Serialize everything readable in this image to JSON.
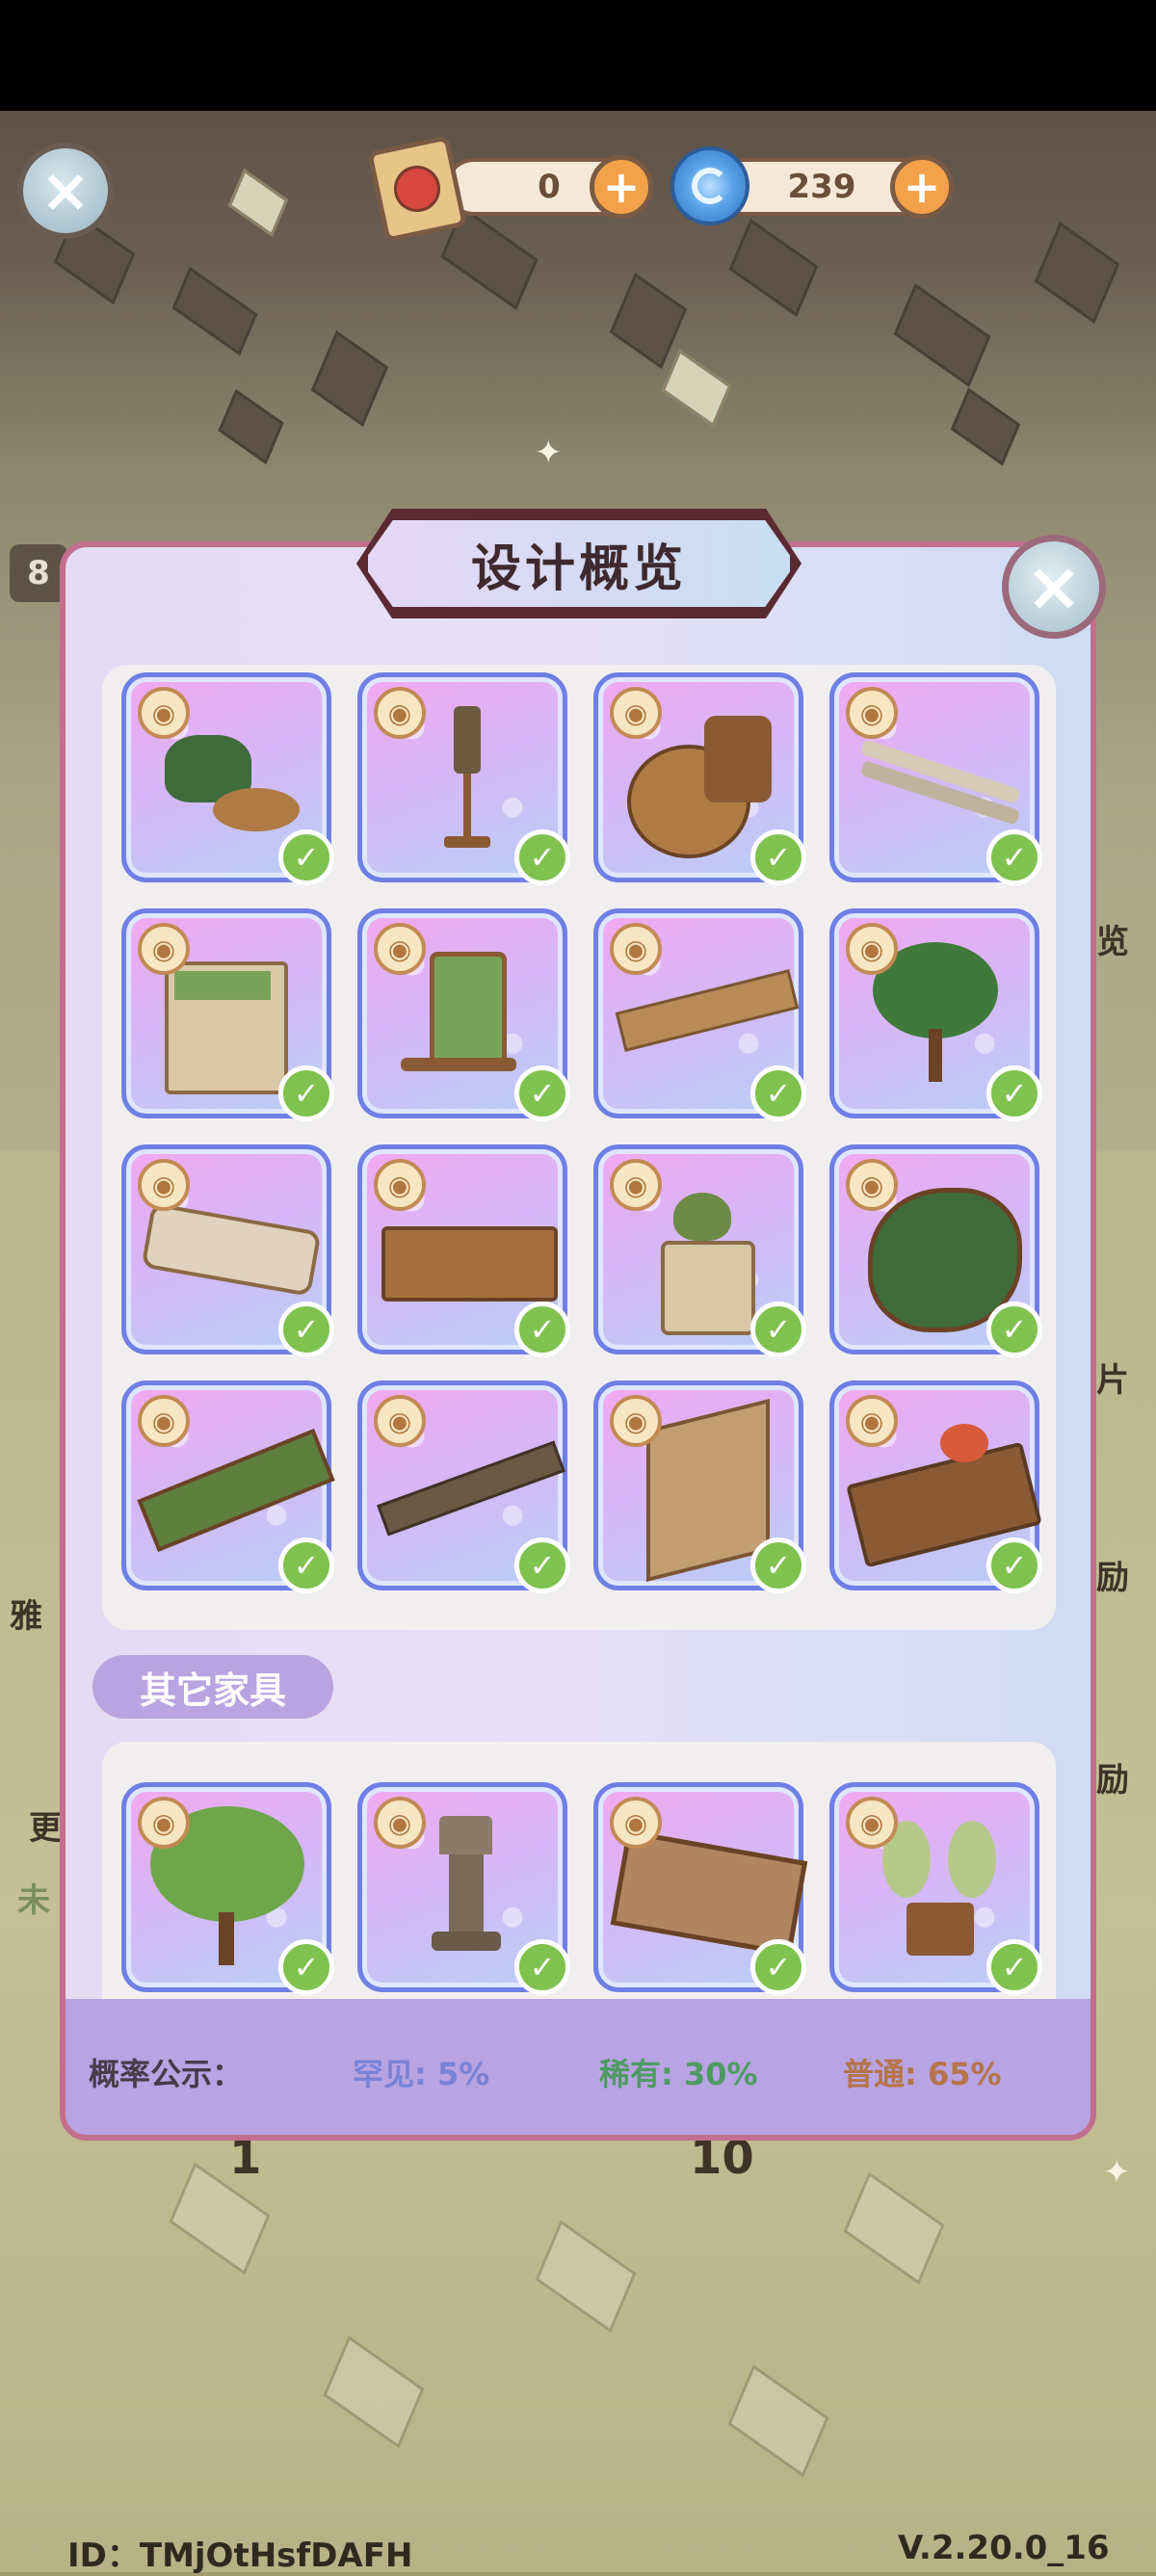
{
  "header": {
    "close_label": "×",
    "ticket_count": "0",
    "ticket_plus": "+",
    "gem_count": "239",
    "gem_plus": "+",
    "ticket_icon": "fruit-ticket-icon",
    "gem_icon": "blue-swirl-icon"
  },
  "background_peeks": {
    "left_badge": "8",
    "left_label_1": "雅",
    "left_label_2": "更",
    "left_label_3": "未",
    "right_label_1": "览",
    "right_label_2": "片",
    "right_label_3": "励",
    "right_label_4": "励",
    "bottom_num_1": "1",
    "bottom_num_2": "10"
  },
  "modal": {
    "title": "设计概览",
    "close_label": "×",
    "items": [
      {
        "name": "tea-table-with-plants",
        "owned": true
      },
      {
        "name": "standing-lantern",
        "owned": true
      },
      {
        "name": "basket-with-gong",
        "owned": true
      },
      {
        "name": "stepping-stones",
        "owned": true
      },
      {
        "name": "wooden-planter-box",
        "owned": true
      },
      {
        "name": "rocking-chair",
        "owned": true
      },
      {
        "name": "wooden-bench",
        "owned": true
      },
      {
        "name": "fruit-tree",
        "owned": true
      },
      {
        "name": "long-trough-table",
        "owned": true
      },
      {
        "name": "wooden-desk",
        "owned": true
      },
      {
        "name": "kettle-stove",
        "owned": true
      },
      {
        "name": "leaf-screen",
        "owned": true
      },
      {
        "name": "tiled-roof-section",
        "owned": true
      },
      {
        "name": "vine-fence",
        "owned": true
      },
      {
        "name": "carved-folding-screen",
        "owned": true
      },
      {
        "name": "tea-serving-tray",
        "owned": true
      }
    ],
    "section_label": "其它家具",
    "other_items": [
      {
        "name": "green-tree",
        "owned": true
      },
      {
        "name": "stone-lantern",
        "owned": true
      },
      {
        "name": "carved-gate",
        "owned": true
      },
      {
        "name": "butterfly-fan-stand",
        "owned": true
      }
    ],
    "probability": {
      "label": "概率公示：",
      "rare": "罕见: 5%",
      "uncommon": "稀有: 30%",
      "common": "普通: 65%",
      "rare_color": "#7a82d6",
      "uncommon_color": "#4f9a63",
      "common_color": "#b5744a"
    }
  },
  "footer": {
    "id_text": "ID：TMjOtHsfDAFH",
    "version": "V.2.20.0_16"
  }
}
